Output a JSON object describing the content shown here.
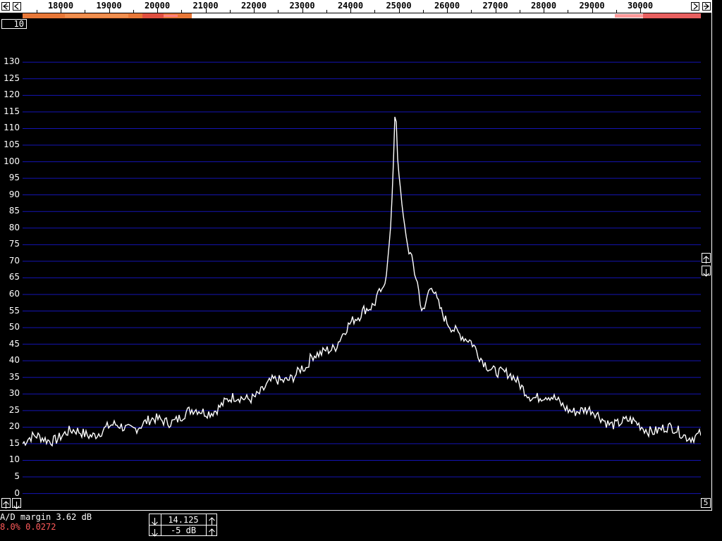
{
  "frequency_scale": {
    "labels": [
      "18000",
      "19000",
      "20000",
      "21000",
      "22000",
      "23000",
      "24000",
      "25000",
      "26000",
      "27000",
      "28000",
      "29000",
      "30000"
    ]
  },
  "averaging": "10",
  "y_axis": {
    "labels": [
      "130",
      "125",
      "120",
      "115",
      "110",
      "105",
      "100",
      "95",
      "90",
      "85",
      "80",
      "75",
      "70",
      "65",
      "60",
      "55",
      "50",
      "45",
      "40",
      "35",
      "30",
      "25",
      "20",
      "15",
      "10",
      "5",
      "0"
    ]
  },
  "status": {
    "ad_margin": "A/D margin 3.62 dB",
    "ad_percent": "8.0% 0.0272"
  },
  "controls": {
    "gain_value": "14.125",
    "zero_value": "-5 dB",
    "right_box": "5"
  },
  "chart_data": {
    "type": "line",
    "x_unit": "Hz",
    "xlim": [
      17200,
      31300
    ],
    "ylim": [
      -2,
      136
    ],
    "grid": true,
    "series": [
      {
        "x": [
          17200,
          17500,
          17800,
          18000,
          18300,
          18600,
          18900,
          19200,
          19500,
          19800,
          20100,
          20400,
          20700,
          21000,
          21200,
          21400,
          21600,
          21800,
          22000,
          22200,
          22400,
          22600,
          22800,
          23000,
          23100,
          23200,
          23400,
          23500,
          23700,
          23800,
          24000,
          24200,
          24300,
          24500,
          24600,
          24700,
          24750,
          24800,
          24850,
          24900,
          24950,
          25000,
          25100,
          25200,
          25300,
          25400,
          25500,
          25550,
          25600,
          25700,
          25800,
          25900,
          26000,
          26200,
          26400,
          26500,
          26600,
          26700,
          26800,
          27000,
          27100,
          27200,
          27300,
          27400,
          27500,
          27700,
          27800,
          28000,
          28200,
          28400,
          28600,
          28800,
          29000,
          29200,
          29400,
          29600,
          29800,
          30000,
          30200,
          30400,
          30600,
          30800,
          31000,
          31300
        ],
        "y": [
          15,
          16.5,
          17,
          17.5,
          18,
          18.5,
          19,
          20,
          20.5,
          21,
          22,
          23,
          24,
          25,
          26,
          27,
          28,
          29,
          30,
          31,
          33,
          34,
          36,
          38,
          37,
          40,
          42,
          44,
          45,
          47,
          50,
          53,
          56,
          58,
          60,
          62,
          64,
          72,
          80,
          95,
          119,
          100,
          85,
          75,
          70,
          65,
          55,
          54,
          58,
          62,
          58,
          55,
          53,
          50,
          46,
          45,
          43,
          41,
          40,
          38,
          37,
          36,
          35,
          34,
          33,
          31,
          30,
          29,
          28,
          27,
          26,
          25,
          24,
          23,
          22,
          21.5,
          21,
          20.5,
          20,
          19.5,
          19,
          18.5,
          18,
          18
        ]
      }
    ]
  },
  "colors": {
    "background": "#000000",
    "grid": "#1414b4",
    "trace": "#ffffff",
    "accent_red": "#ff5a5a"
  }
}
